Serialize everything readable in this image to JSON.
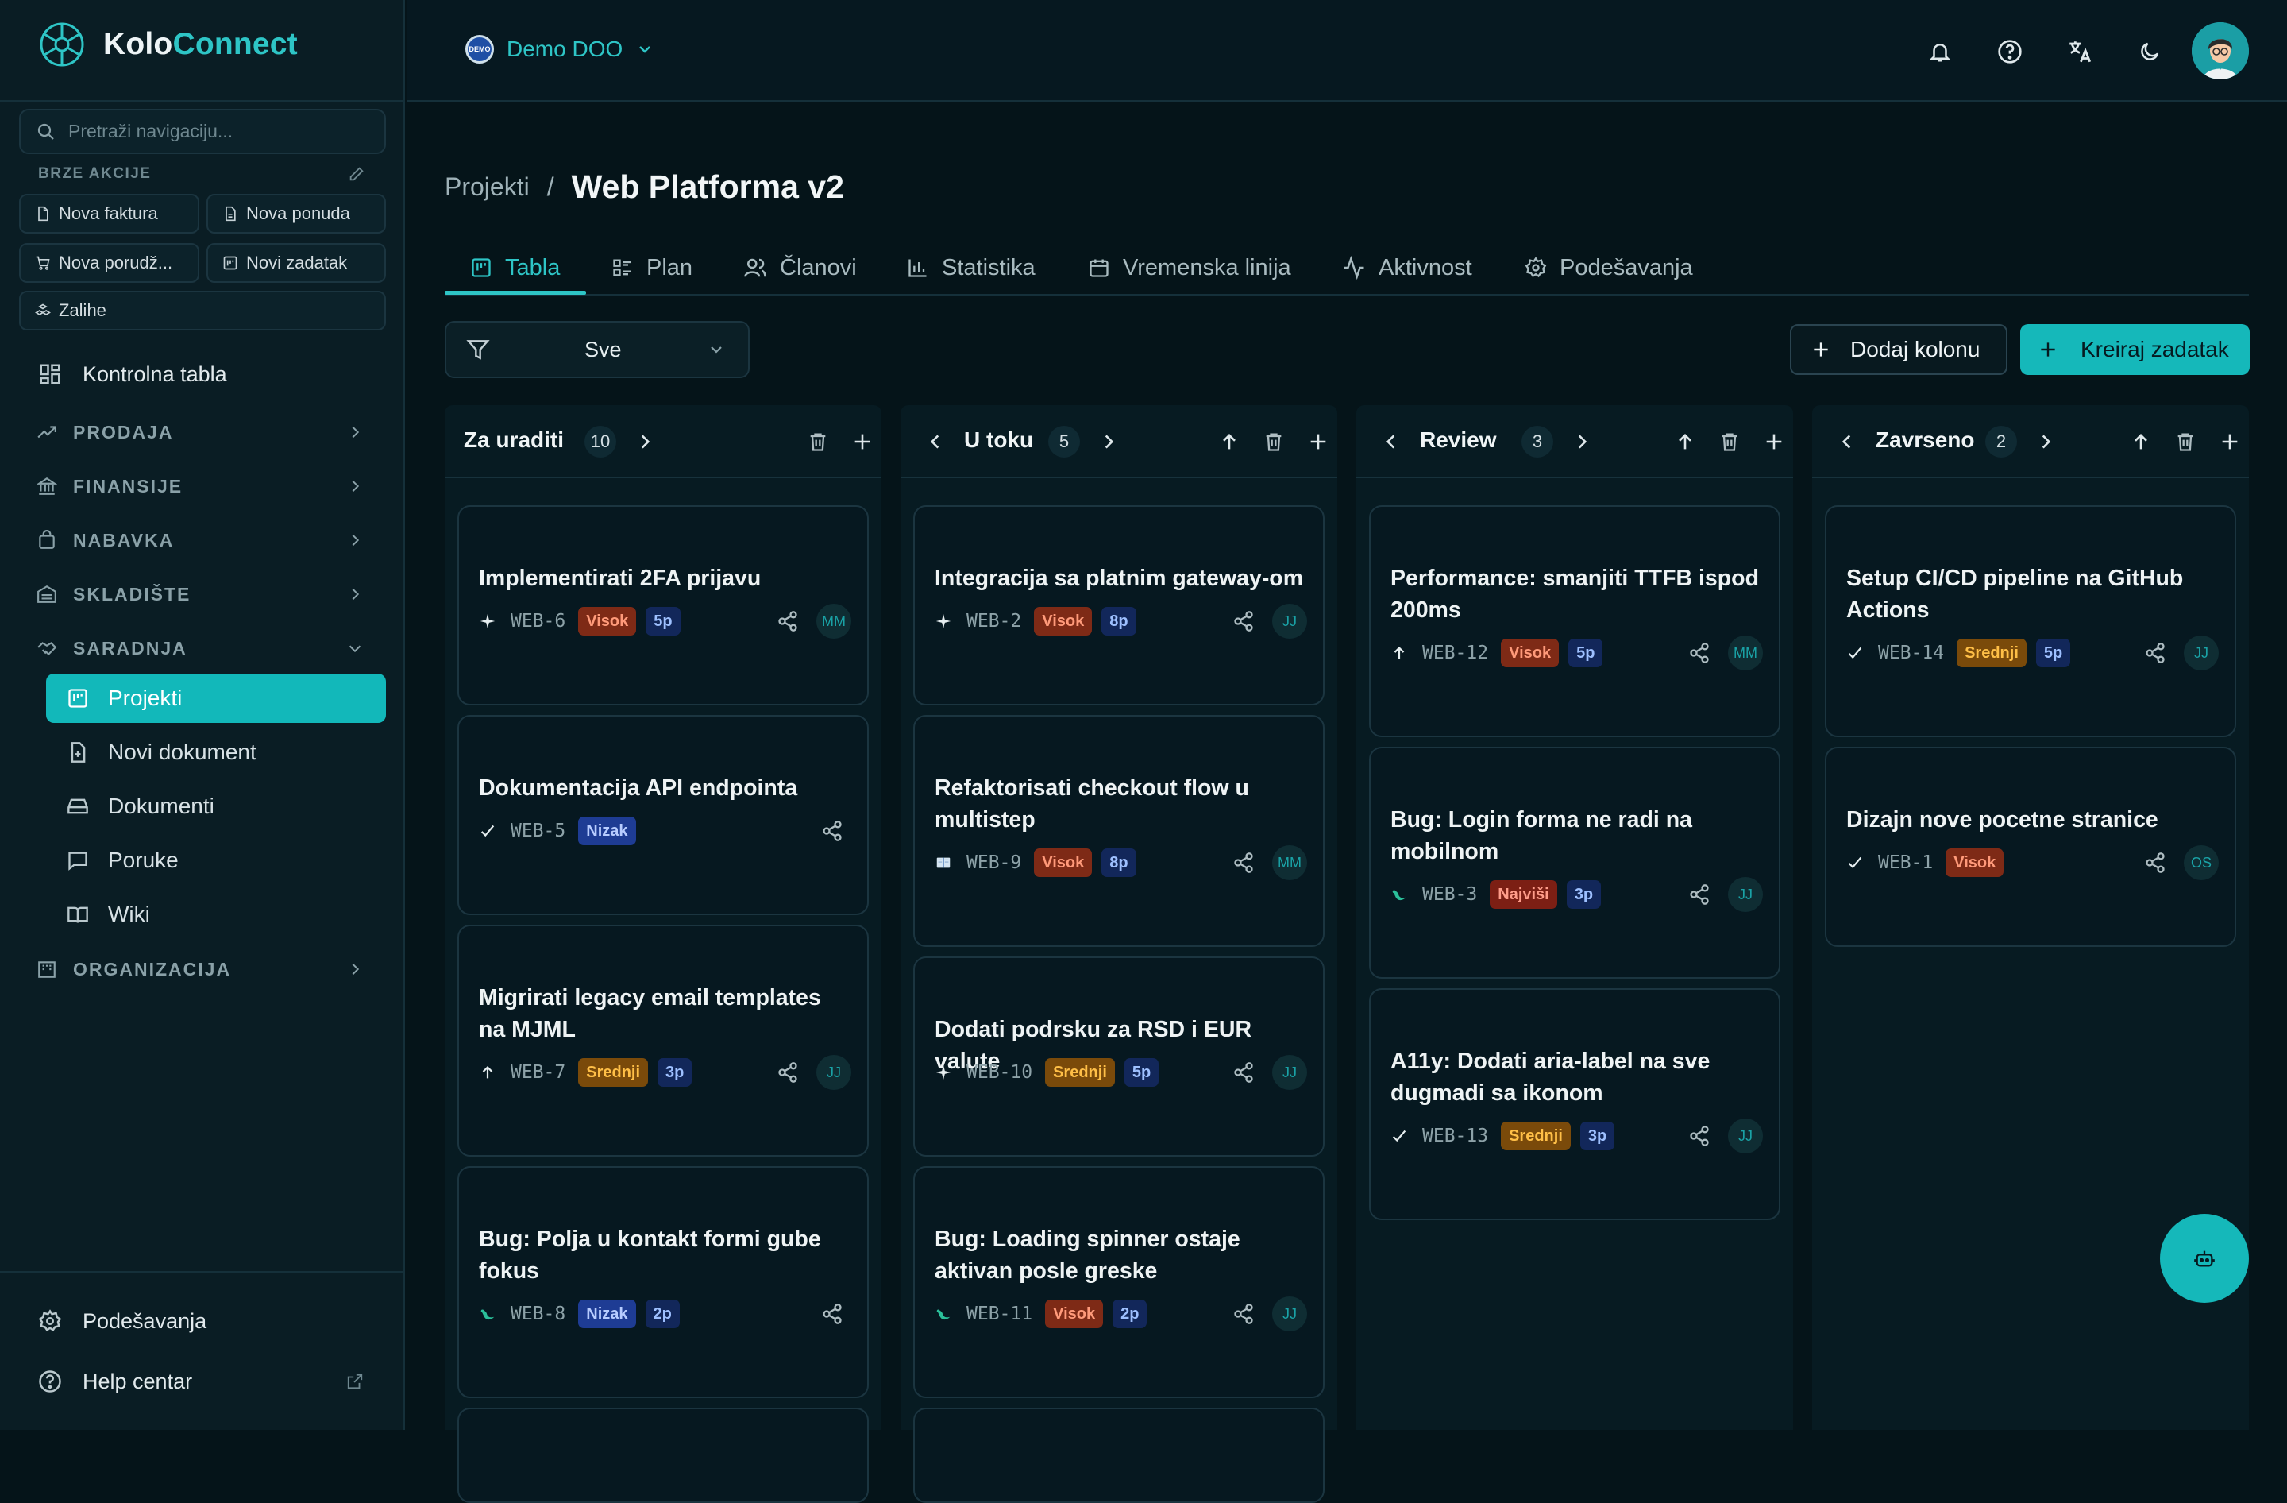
{
  "app": {
    "name_part1": "Kolo",
    "name_part2": "Connect"
  },
  "sidebar": {
    "search_placeholder": "Pretraži navigaciju...",
    "quick_actions_title": "BRZE AKCIJE",
    "quick_actions": [
      "Nova faktura",
      "Nova ponuda",
      "Nova porudž...",
      "Novi zadatak",
      "Zalihe"
    ],
    "dashboard": "Kontrolna tabla",
    "groups": [
      "PRODAJA",
      "FINANSIJE",
      "NABAVKA",
      "SKLADIŠTE",
      "SARADNJA",
      "ORGANIZACIJA"
    ],
    "saradnja_items": [
      "Projekti",
      "Novi dokument",
      "Dokumenti",
      "Poruke",
      "Wiki"
    ],
    "active_item": "Projekti",
    "settings": "Podešavanja",
    "help": "Help centar"
  },
  "topbar": {
    "org_name": "Demo DOO",
    "org_badge": "DEMO",
    "icons": [
      "bell-icon",
      "help-icon",
      "translate-icon",
      "moon-icon"
    ]
  },
  "breadcrumb": {
    "parent": "Projekti",
    "separator": "/",
    "title": "Web Platforma v2"
  },
  "tabs": [
    "Tabla",
    "Plan",
    "Članovi",
    "Statistika",
    "Vremenska linija",
    "Aktivnost",
    "Podešavanja"
  ],
  "active_tab": "Tabla",
  "filter": {
    "value": "Sve"
  },
  "actions": {
    "add_column": "Dodaj kolonu",
    "create_task": "Kreiraj zadatak"
  },
  "colors": {
    "accent": "#15b8ba",
    "background": "#051419",
    "sidebar": "#0a1d24"
  },
  "columns": [
    {
      "title": "Za uraditi",
      "count": "10",
      "cards": [
        {
          "title": "Implementirati 2FA prijavu",
          "type_icon": "sparkle-icon",
          "code": "WEB-6",
          "priority": "Visok",
          "points": "5p",
          "assignee": "MM"
        },
        {
          "title": "Dokumentacija API endpointa",
          "type_icon": "check-icon",
          "code": "WEB-5",
          "priority": "Nizak",
          "points": "",
          "assignee": ""
        },
        {
          "title": "Migrirati legacy email templates na MJML",
          "type_icon": "arrow-up-icon",
          "code": "WEB-7",
          "priority": "Srednji",
          "points": "3p",
          "assignee": "JJ"
        },
        {
          "title": "Bug: Polja u kontakt formi gube fokus",
          "type_icon": "bug-icon",
          "code": "WEB-8",
          "priority": "Nizak",
          "points": "2p",
          "assignee": ""
        }
      ]
    },
    {
      "title": "U toku",
      "count": "5",
      "cards": [
        {
          "title": "Integracija sa platnim gateway-om",
          "type_icon": "sparkle-icon",
          "code": "WEB-2",
          "priority": "Visok",
          "points": "8p",
          "assignee": "JJ"
        },
        {
          "title": "Refaktorisati checkout flow u multistep",
          "type_icon": "book-icon",
          "code": "WEB-9",
          "priority": "Visok",
          "points": "8p",
          "assignee": "MM"
        },
        {
          "title": "Dodati podrsku za RSD i EUR valute",
          "type_icon": "sparkle-icon",
          "code": "WEB-10",
          "priority": "Srednji",
          "points": "5p",
          "assignee": "JJ"
        },
        {
          "title": "Bug: Loading spinner ostaje aktivan posle greske",
          "type_icon": "bug-icon",
          "code": "WEB-11",
          "priority": "Visok",
          "points": "2p",
          "assignee": "JJ"
        }
      ]
    },
    {
      "title": "Review",
      "count": "3",
      "cards": [
        {
          "title": "Performance: smanjiti TTFB ispod 200ms",
          "type_icon": "arrow-up-icon",
          "code": "WEB-12",
          "priority": "Visok",
          "points": "5p",
          "assignee": "MM"
        },
        {
          "title": "Bug: Login forma ne radi na mobilnom",
          "type_icon": "bug-icon",
          "code": "WEB-3",
          "priority": "Najviši",
          "points": "3p",
          "assignee": "JJ"
        },
        {
          "title": "A11y: Dodati aria-label na sve dugmadi sa ikonom",
          "type_icon": "check-icon",
          "code": "WEB-13",
          "priority": "Srednji",
          "points": "3p",
          "assignee": "JJ"
        }
      ]
    },
    {
      "title": "Zavrseno",
      "count": "2",
      "cards": [
        {
          "title": "Setup CI/CD pipeline na GitHub Actions",
          "type_icon": "check-icon",
          "code": "WEB-14",
          "priority": "Srednji",
          "points": "5p",
          "assignee": "JJ"
        },
        {
          "title": "Dizajn nove pocetne stranice",
          "type_icon": "check-icon",
          "code": "WEB-1",
          "priority": "Visok",
          "points": "",
          "assignee": "OS"
        }
      ]
    }
  ]
}
